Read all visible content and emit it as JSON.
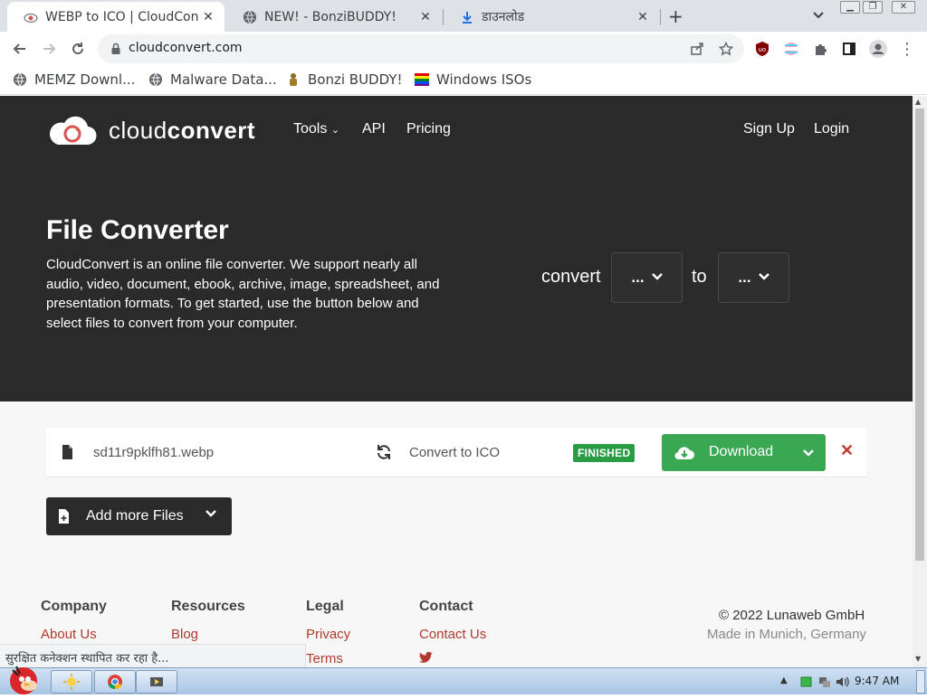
{
  "browser": {
    "tabs": [
      {
        "title": "WEBP to ICO | CloudConvert",
        "icon": "cloud-favicon",
        "active": true
      },
      {
        "title": "NEW! - BonziBUDDY!",
        "icon": "globe-icon",
        "active": false
      },
      {
        "title": "डाउनलोड",
        "icon": "download-icon",
        "active": false
      }
    ],
    "new_tab": "+",
    "close_glyph": "✕",
    "url": "cloudconvert.com",
    "bookmarks": [
      {
        "label": "MEMZ Downl...",
        "icon": "globe-icon"
      },
      {
        "label": "Malware Data...",
        "icon": "globe-icon"
      },
      {
        "label": "Bonzi BUDDY!",
        "icon": "bonzi-icon"
      },
      {
        "label": "Windows ISOs",
        "icon": "windows-flag-icon"
      }
    ]
  },
  "site": {
    "brand_light": "cloud",
    "brand_bold": "convert",
    "nav": {
      "tools": "Tools",
      "api": "API",
      "pricing": "Pricing",
      "signup": "Sign Up",
      "login": "Login"
    },
    "hero": {
      "title": "File Converter",
      "description": "CloudConvert is an online file converter. We support nearly all audio, video, document, ebook, archive, image, spreadsheet, and presentation formats. To get started, use the button below and select files to convert from your computer.",
      "convert_word": "convert",
      "to_word": "to",
      "from_select": "...",
      "to_select": "..."
    },
    "file": {
      "name": "sd11r9pklfh81.webp",
      "convert_label": "Convert to ICO",
      "status": "FINISHED",
      "download_label": "Download",
      "remove": "✕"
    },
    "add_files_label": "Add more Files",
    "footer": {
      "company_heading": "Company",
      "company_link": "About Us",
      "resources_heading": "Resources",
      "resources_link": "Blog",
      "legal_heading": "Legal",
      "legal_links": [
        "Privacy",
        "Terms"
      ],
      "contact_heading": "Contact",
      "contact_link": "Contact Us",
      "copyright": "© 2022 Lunaweb GmbH",
      "made_in": "Made in Munich, Germany"
    }
  },
  "status_bubble": "सुरक्षित कनेक्शन स्थापित कर रहा है...",
  "taskbar": {
    "clock": "9:47 AM"
  },
  "colors": {
    "hero_bg": "#2a2a2a",
    "download_green": "#3aa853",
    "badge_green": "#2a9d44",
    "link_red": "#b03a2e"
  }
}
